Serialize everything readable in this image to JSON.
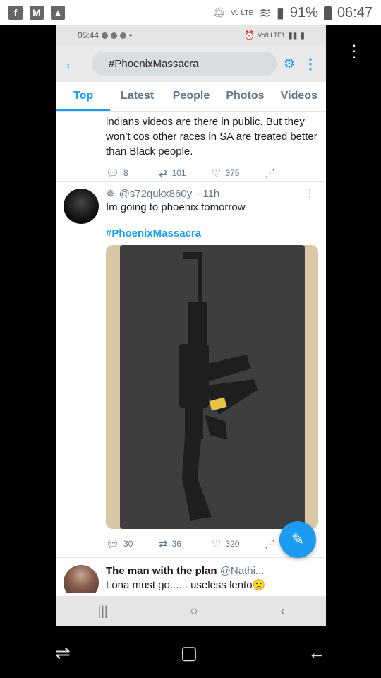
{
  "outer_status": {
    "left_icons": [
      "facebook-icon",
      "mail-icon",
      "image-icon"
    ],
    "vo_lte": "Vo LTE",
    "battery": "91%",
    "time": "06:47"
  },
  "inner_status": {
    "time": "05:44",
    "net": "Vo8 LTE1"
  },
  "header": {
    "search_query": "#PhoenixMassacra"
  },
  "tabs": [
    {
      "label": "Top",
      "active": true
    },
    {
      "label": "Latest"
    },
    {
      "label": "People"
    },
    {
      "label": "Photos"
    },
    {
      "label": "Videos"
    }
  ],
  "prev_tweet": {
    "text": "indians videos are there in public. But they won't cos other races in SA are treated better than Black people.",
    "replies": "8",
    "retweets": "101",
    "likes": "375"
  },
  "tweet": {
    "handle": "@s72qukx860y",
    "time": "· 11h",
    "text": "Im going to phoenix tomorrow",
    "hashtag": "#PhoenixMassacra",
    "replies": "30",
    "retweets": "36",
    "likes": "320"
  },
  "next_tweet": {
    "name": "The man with the plan",
    "handle": "@Nathi...",
    "text": "Lona must go...... useless lento🙁"
  },
  "colors": {
    "accent": "#1d9bf0",
    "muted": "#657786"
  }
}
